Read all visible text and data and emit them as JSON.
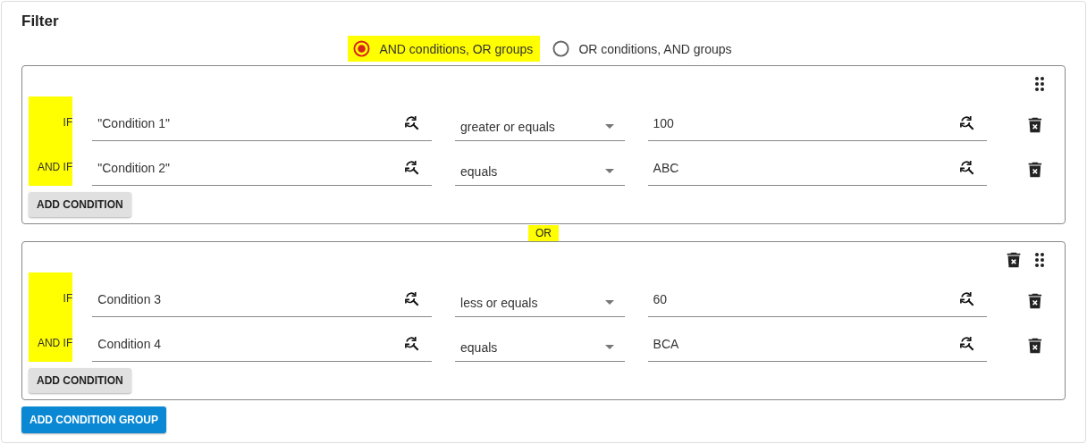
{
  "title": "Filter",
  "mode_options": [
    {
      "label": "AND conditions, OR groups",
      "selected": true
    },
    {
      "label": "OR conditions, AND groups",
      "selected": false
    }
  ],
  "group_connector": "OR",
  "groups": [
    {
      "deletable": false,
      "add_condition": "ADD CONDITION",
      "conditions": [
        {
          "connector": "IF",
          "field": "\"Condition 1\"",
          "operator": "greater or equals",
          "value": "100"
        },
        {
          "connector": "AND IF",
          "field": "\"Condition 2\"",
          "operator": "equals",
          "value": "ABC"
        }
      ]
    },
    {
      "deletable": true,
      "add_condition": "ADD CONDITION",
      "conditions": [
        {
          "connector": "IF",
          "field": "Condition 3",
          "operator": "less or equals",
          "value": "60"
        },
        {
          "connector": "AND IF",
          "field": "Condition 4",
          "operator": "equals",
          "value": "BCA"
        }
      ]
    }
  ],
  "add_group": "ADD CONDITION GROUP"
}
